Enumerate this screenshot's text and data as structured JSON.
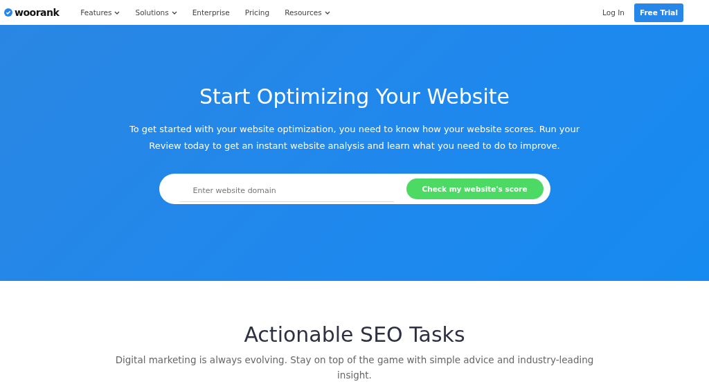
{
  "nav": {
    "brand": "woorank",
    "items": [
      {
        "label": "Features",
        "dropdown": true
      },
      {
        "label": "Solutions",
        "dropdown": true
      },
      {
        "label": "Enterprise",
        "dropdown": false
      },
      {
        "label": "Pricing",
        "dropdown": false
      },
      {
        "label": "Resources",
        "dropdown": true
      }
    ],
    "login": "Log In",
    "cta": "Free Trial"
  },
  "hero": {
    "title": "Start Optimizing Your Website",
    "subtitle": "To get started with your website optimization, you need to know how your website scores. Run your Review today to get an instant website analysis and learn what you need to do to improve.",
    "search": {
      "placeholder": "Enter website domain"
    },
    "button": "Check my website's score"
  },
  "section": {
    "title": "Actionable SEO Tasks",
    "text": "Digital marketing is always evolving. Stay on top of the game with simple advice and industry-leading insight."
  }
}
